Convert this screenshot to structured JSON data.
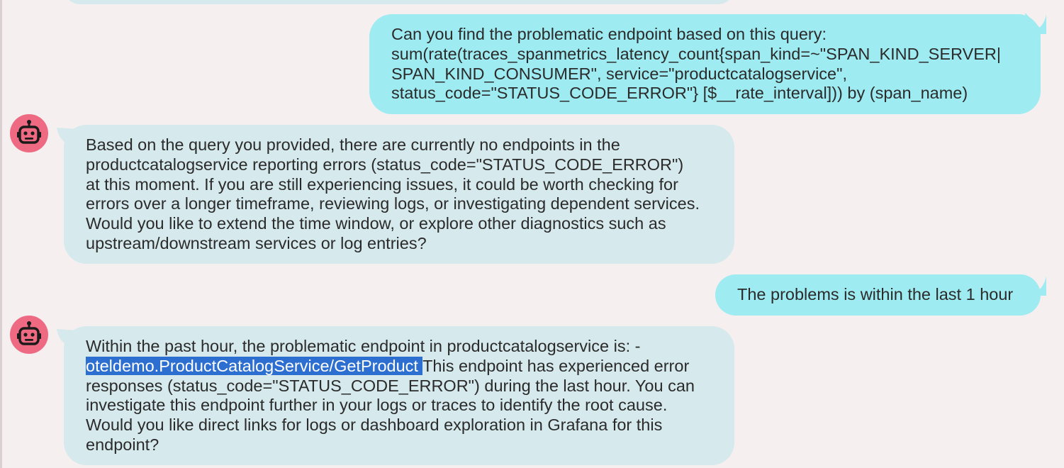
{
  "colors": {
    "user_bubble": "#9eebf1",
    "bot_bubble": "#d6e9ec",
    "avatar_bg": "#ee6a82",
    "selection": "#2d6fd0",
    "background": "#f5f0ef"
  },
  "icons": {
    "avatar": "robot-icon"
  },
  "messages": [
    {
      "role": "user",
      "lines": [
        "Can you find the problematic endpoint based on this query:",
        "sum(rate(traces_spanmetrics_latency_count{span_kind=~\"SPAN_KIND_SERVER|",
        "SPAN_KIND_CONSUMER\", service=\"productcatalogservice\",",
        "status_code=\"STATUS_CODE_ERROR\"} [$__rate_interval])) by (span_name)"
      ]
    },
    {
      "role": "assistant",
      "lines": [
        "Based on the query you provided, there are currently no endpoints in the",
        "productcatalogservice reporting errors (status_code=\"STATUS_CODE_ERROR\")",
        "at this moment. If you are still experiencing issues, it could be worth checking for",
        "errors over a longer timeframe, reviewing logs, or investigating dependent services.",
        "Would you like to extend the time window, or explore other diagnostics such as",
        "upstream/downstream services or log entries?"
      ]
    },
    {
      "role": "user",
      "lines": [
        "The problems is within the last 1 hour"
      ]
    },
    {
      "role": "assistant",
      "line1": "Within the past hour, the problematic endpoint in productcatalogservice is: -",
      "line2_selected": "oteldemo.ProductCatalogService/GetProduct ",
      "line2_rest": "This endpoint has experienced error",
      "lines": [
        "responses (status_code=\"STATUS_CODE_ERROR\") during the last hour. You can",
        "investigate this endpoint further in your logs or traces to identify the root cause.",
        "Would you like direct links for logs or dashboard exploration in Grafana for this",
        "endpoint?"
      ]
    }
  ]
}
